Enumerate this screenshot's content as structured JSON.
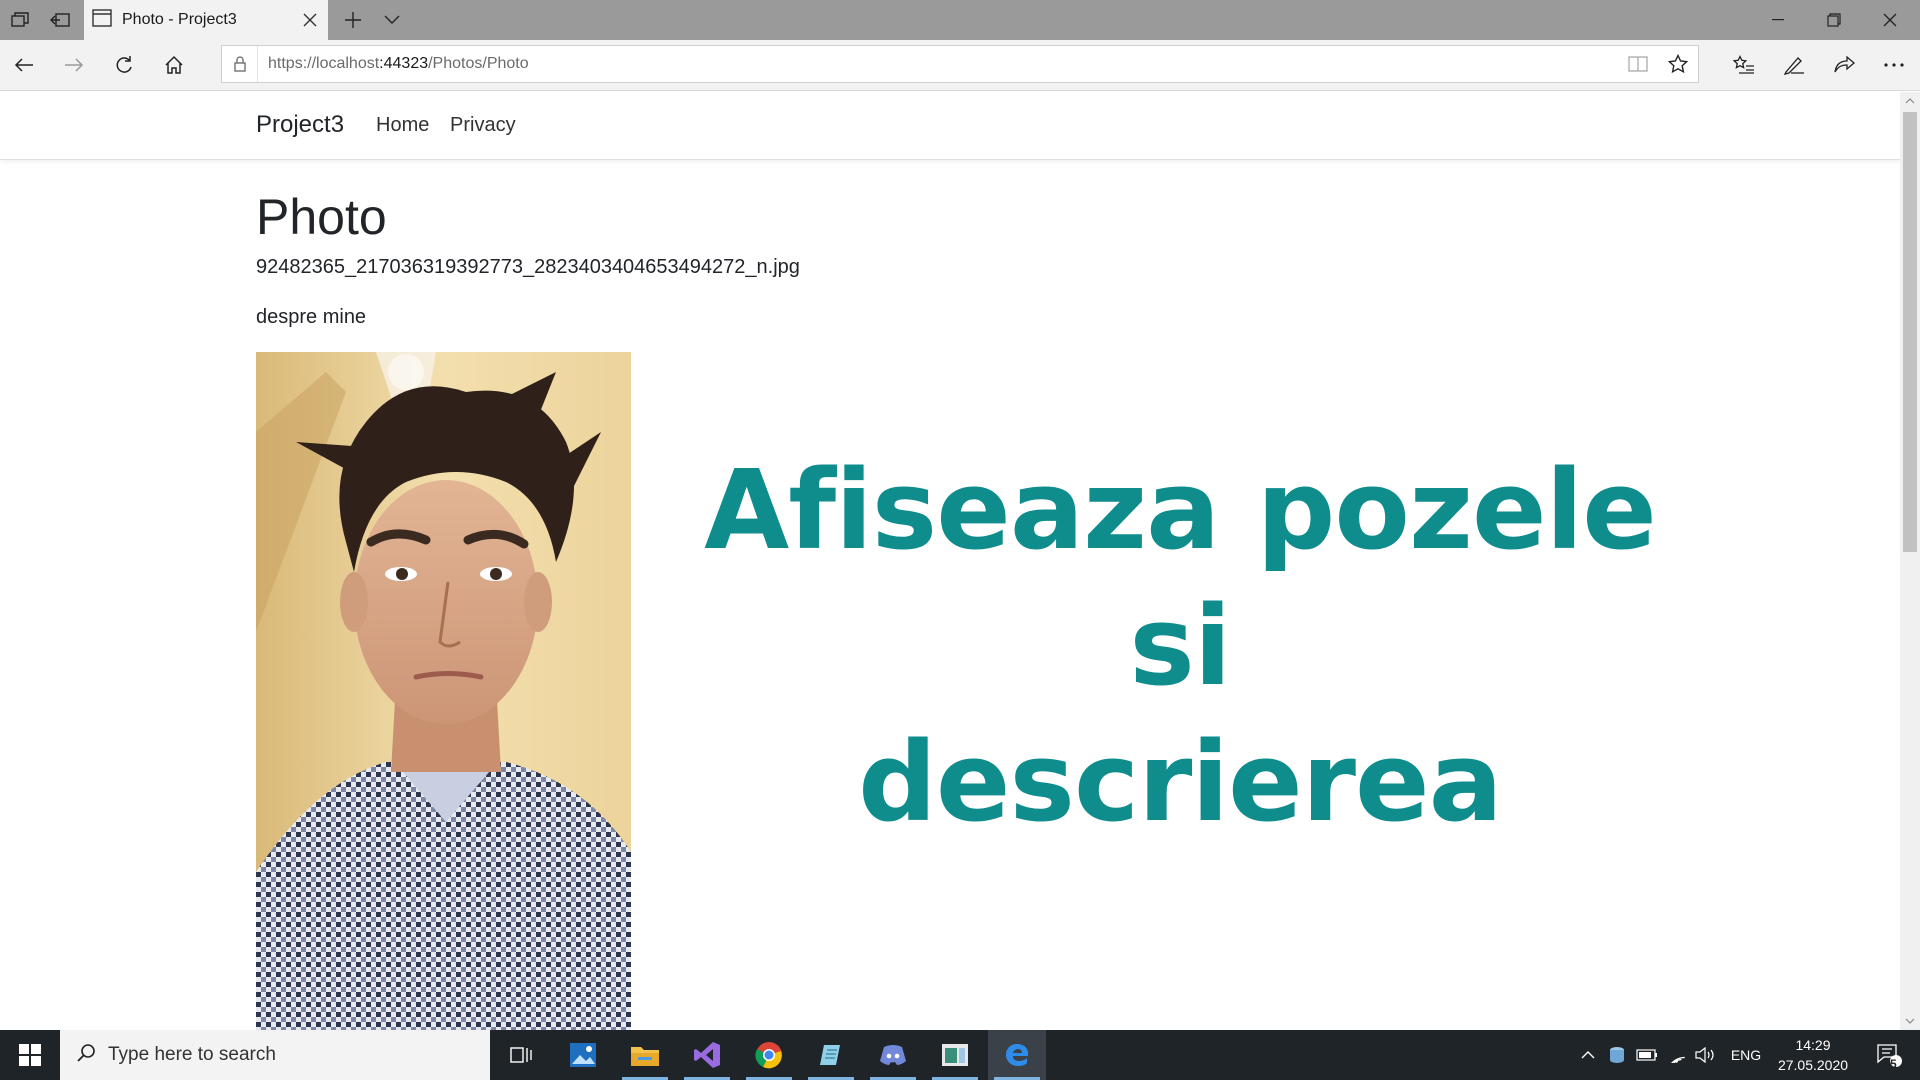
{
  "browser": {
    "tab_title": "Photo - Project3",
    "url_host": "https://localhost",
    "url_port": ":44323",
    "url_path": "/Photos/Photo"
  },
  "site": {
    "brand": "Project3",
    "nav": [
      {
        "label": "Home"
      },
      {
        "label": "Privacy"
      }
    ]
  },
  "main": {
    "heading": "Photo",
    "file_name": "92482365_217036319392773_2823403404653494272_n.jpg",
    "description": "despre mine",
    "banner_line1": "Afiseaza pozele si",
    "banner_line2": "descrierea"
  },
  "taskbar": {
    "search_placeholder": "Type here to search",
    "language": "ENG",
    "time": "14:29",
    "date": "27.05.2020",
    "notifications_count": "5"
  },
  "colors": {
    "banner": "#0f8c8c",
    "taskbar": "#1f2428",
    "tabbar": "#9a9a9a"
  }
}
